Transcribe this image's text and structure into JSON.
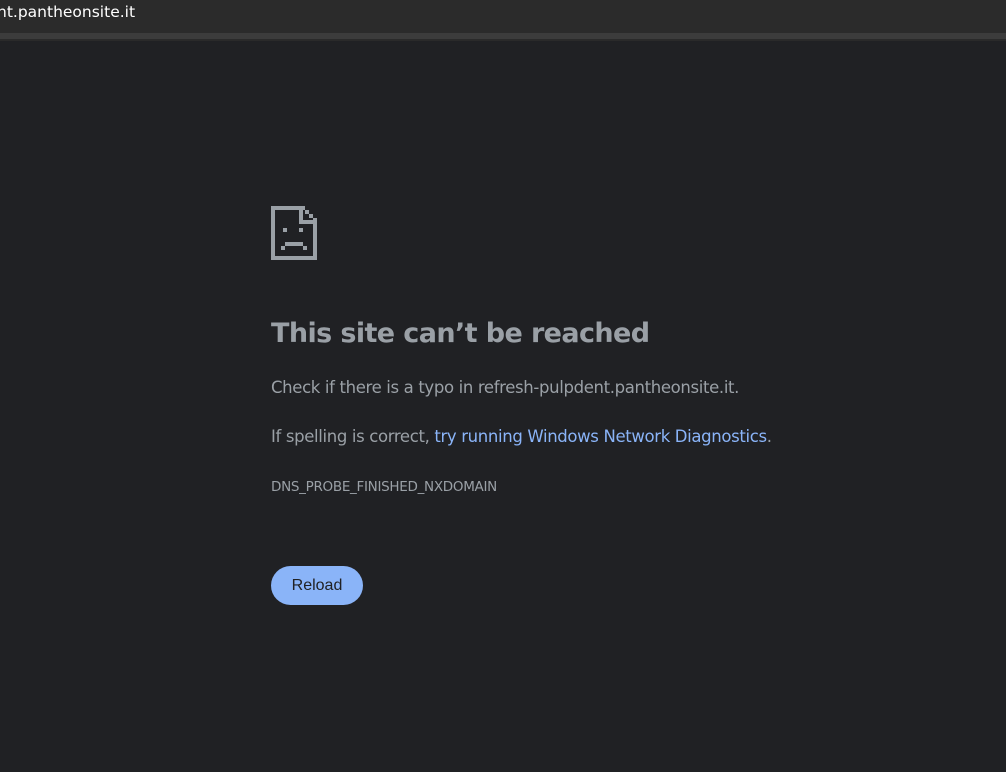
{
  "address_bar": {
    "url_text": "nt.pantheonsite.it"
  },
  "error_page": {
    "icon": "sad-page-icon",
    "heading": "This site can’t be reached",
    "typo_message": "Check if there is a typo in refresh-pulpdent.pantheonsite.it.",
    "spelling_prefix": "If spelling is correct, ",
    "diagnostics_link": "try running Windows Network Diagnostics",
    "spelling_suffix": ".",
    "error_code": "DNS_PROBE_FINISHED_NXDOMAIN",
    "reload_label": "Reload"
  },
  "colors": {
    "background": "#202124",
    "text": "#9aa0a6",
    "link": "#8ab4f8",
    "button": "#8ab4f8"
  }
}
